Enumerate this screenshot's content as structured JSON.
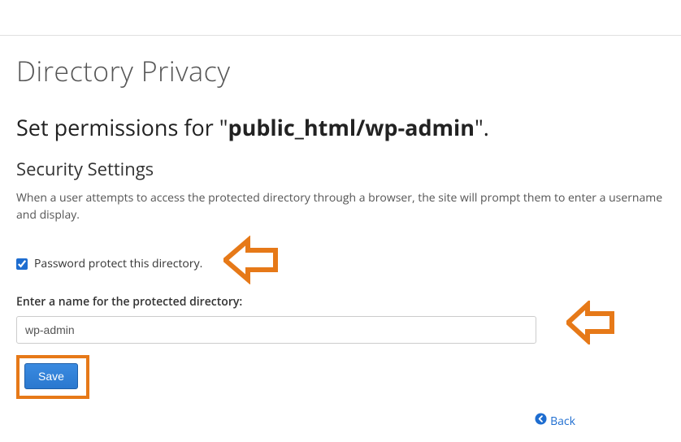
{
  "page": {
    "title": "Directory Privacy"
  },
  "permissions": {
    "prefix": "Set permissions for \"",
    "path": "public_html/wp-admin",
    "suffix": "\"."
  },
  "section": {
    "title": "Security Settings",
    "description": "When a user attempts to access the protected directory through a browser, the site will prompt them to enter a username and display."
  },
  "checkbox": {
    "label": "Password protect this directory.",
    "checked": true
  },
  "directory_name": {
    "label": "Enter a name for the protected directory:",
    "value": "wp-admin"
  },
  "buttons": {
    "save": "Save",
    "back": "Back"
  },
  "colors": {
    "accent": "#1e6dd0",
    "annotation": "#e67918"
  }
}
